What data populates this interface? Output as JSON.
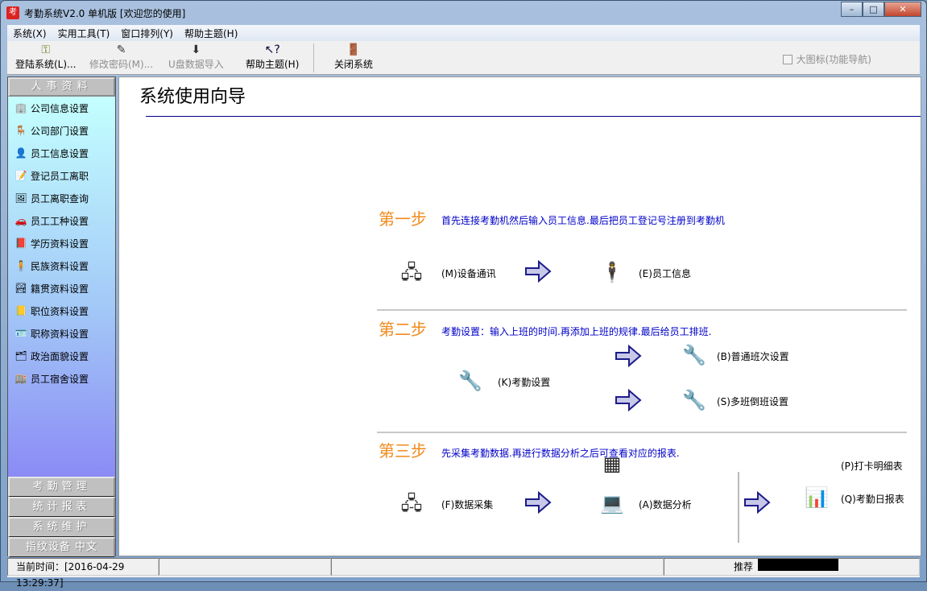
{
  "window": {
    "title": "考勤系统V2.0 单机版 [欢迎您的使用]",
    "app_icon": "考",
    "min": "–",
    "max": "□",
    "close": "✕"
  },
  "menu": [
    "系统(X)",
    "实用工具(T)",
    "窗口排列(Y)",
    "帮助主题(H)"
  ],
  "toolbar": {
    "login": "登陆系统(L)...",
    "change_password": "修改密码(M)...",
    "usb_import": "U盘数据导入",
    "help": "帮助主题(H)",
    "close": "关闭系统",
    "large_icons": "大图标(功能导航)"
  },
  "sidebar": {
    "header": "人事资料",
    "items": [
      "公司信息设置",
      "公司部门设置",
      "员工信息设置",
      "登记员工离职",
      "员工离职查询",
      "员工工种设置",
      "学历资料设置",
      "民族资料设置",
      "籍贯资料设置",
      "职位资料设置",
      "职称资料设置",
      "政治面貌设置",
      "员工宿舍设置"
    ],
    "sections": [
      "考勤管理",
      "统计报表",
      "系统维护",
      "指纹设备 中文"
    ]
  },
  "main": {
    "title": "系统使用向导",
    "step1": {
      "label": "第一步",
      "desc": "首先连接考勤机然后输入员工信息.最后把员工登记号注册到考勤机",
      "a": "(M)设备通讯",
      "b": "(E)员工信息"
    },
    "step2": {
      "label": "第二步",
      "desc": "考勤设置：输入上班的时间.再添加上班的规律.最后给员工排班.",
      "a": "(K)考勤设置",
      "b": "(B)普通班次设置",
      "c": "(S)多班倒班设置"
    },
    "step3": {
      "label": "第三步",
      "desc": "先采集考勤数据.再进行数据分析之后可查看对应的报表.",
      "a": "(F)数据采集",
      "b": "(A)数据分析",
      "c": "(P)打卡明细表",
      "d": "(Q)考勤日报表"
    }
  },
  "status": {
    "time": "当前时间：[2016-04-29 13:29:37]",
    "recommend": "推荐"
  }
}
